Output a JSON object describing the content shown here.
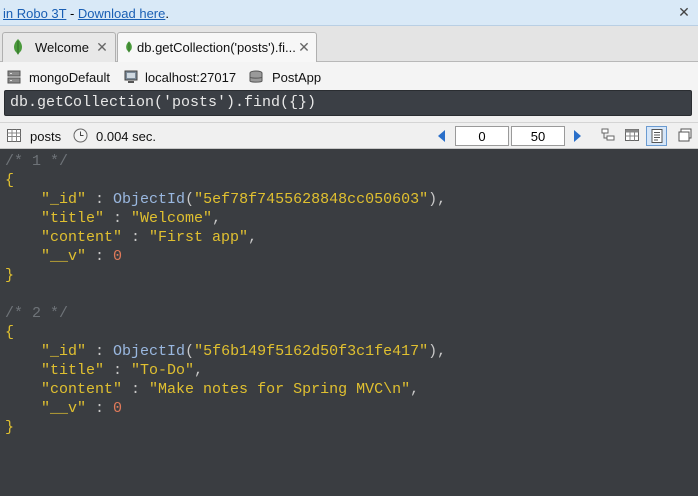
{
  "banner": {
    "prefix": "in Robo 3T",
    "separator": " - ",
    "link": "Download here",
    "suffix": "."
  },
  "tabs": [
    {
      "label": "Welcome",
      "active": false
    },
    {
      "label": "db.getCollection('posts').fi...",
      "active": true
    }
  ],
  "info": {
    "connection": "mongoDefault",
    "host": "localhost:27017",
    "database": "PostApp"
  },
  "query": {
    "text": "db.getCollection('posts').find({})"
  },
  "toolbar": {
    "collection": "posts",
    "time": "0.004 sec.",
    "skip": "0",
    "limit": "50"
  },
  "documents": [
    {
      "comment": "/* 1 */",
      "id": "\"5ef78f7455628848cc050603\"",
      "title": "\"Welcome\"",
      "content": "\"First app\"",
      "v": "0"
    },
    {
      "comment": "/* 2 */",
      "id": "\"5f6b149f5162d50f3c1fe417\"",
      "title": "\"To-Do\"",
      "content": "\"Make notes for Spring MVC\\n\"",
      "v": "0"
    }
  ],
  "syntax": {
    "open": "{",
    "close": "}",
    "key_id": "\"_id\"",
    "key_title": "\"title\"",
    "key_content": "\"content\"",
    "key_v": "\"__v\"",
    "colon": " : ",
    "comma": ",",
    "objectid": "ObjectId",
    "lparen": "(",
    "rparen": ")"
  }
}
